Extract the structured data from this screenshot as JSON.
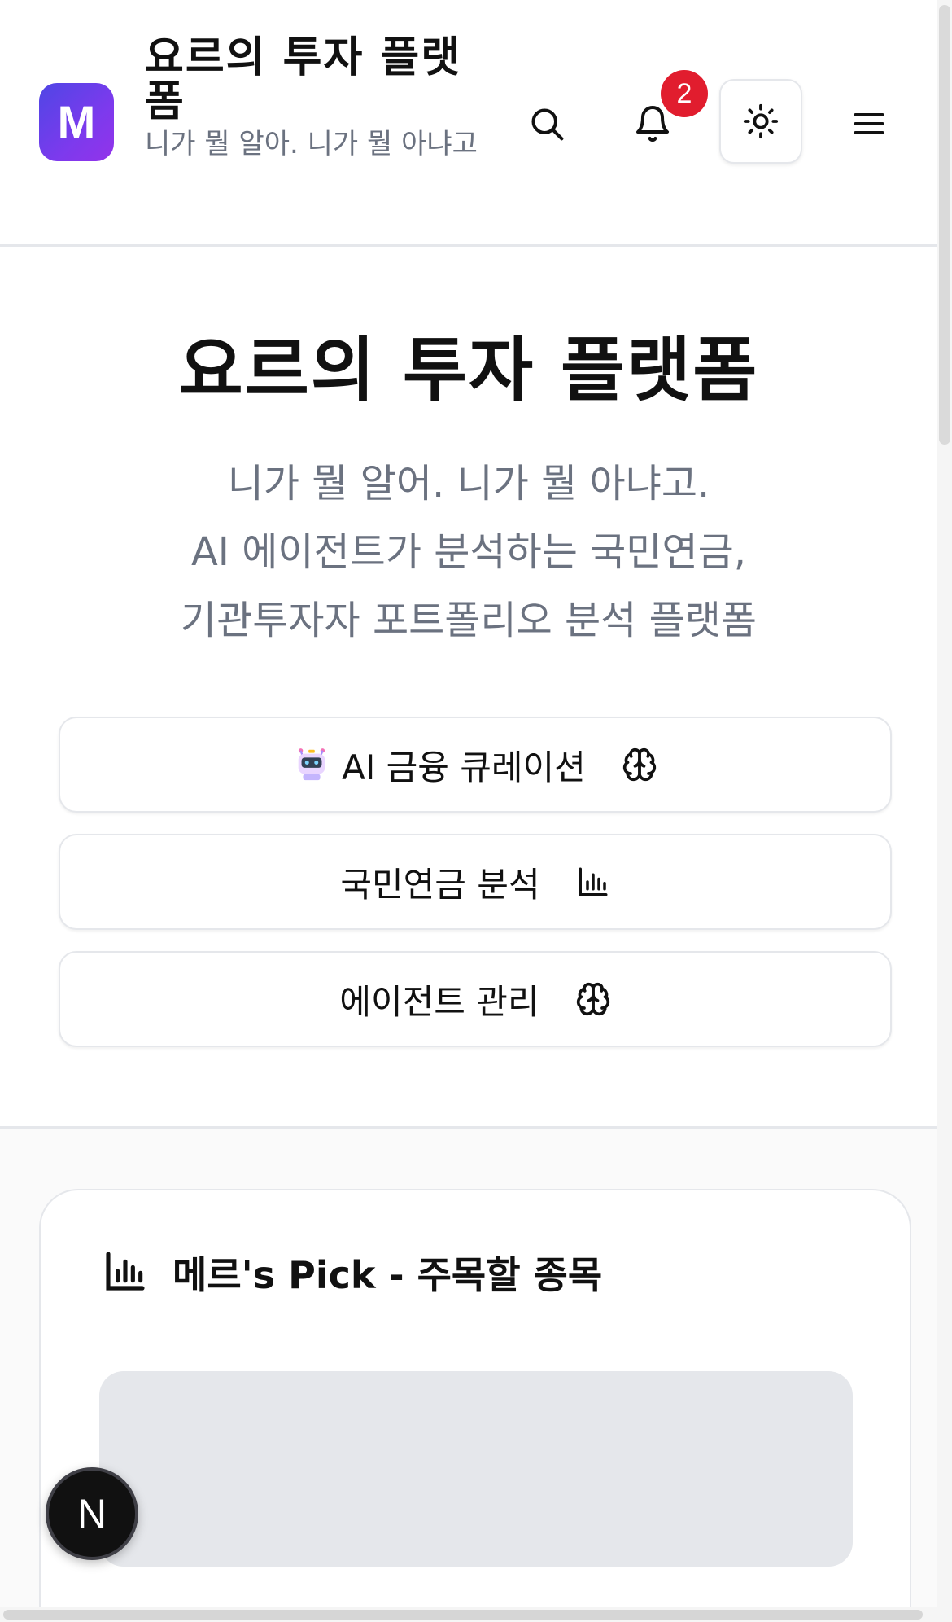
{
  "header": {
    "logo_letter": "M",
    "title": "요르의 투자 플랫폼",
    "subtitle": "니가 뭘 알아. 니가 뭘 아냐고",
    "notification_count": "2",
    "icons": {
      "search": "search-icon",
      "notifications": "bell-icon",
      "theme": "sun-icon",
      "menu": "hamburger-menu-icon"
    }
  },
  "hero": {
    "title": "요르의 투자 플랫폼",
    "description_lines": [
      "니가 뭘 알어. 니가 뭘 아냐고.",
      "AI 에이전트가 분석하는 국민연금,",
      "기관투자자 포트폴리오 분석 플랫폼"
    ]
  },
  "actions": [
    {
      "label": "AI 금융 큐레이션",
      "lead_icon": "robot-icon",
      "trail_icon": "brain-icon"
    },
    {
      "label": "국민연금 분석",
      "trail_icon": "bar-chart-icon"
    },
    {
      "label": "에이전트 관리",
      "trail_icon": "brain-icon"
    }
  ],
  "pick": {
    "icon": "bar-chart-icon",
    "title": "메르's Pick - 주목할 종목"
  },
  "fab": {
    "label": "N"
  },
  "colors": {
    "logo_gradient_start": "#4f46e5",
    "logo_gradient_end": "#9333ea",
    "badge": "#e11d2e",
    "muted_text": "#6b7280",
    "border": "#e5e7eb",
    "skeleton": "#e5e7eb"
  }
}
